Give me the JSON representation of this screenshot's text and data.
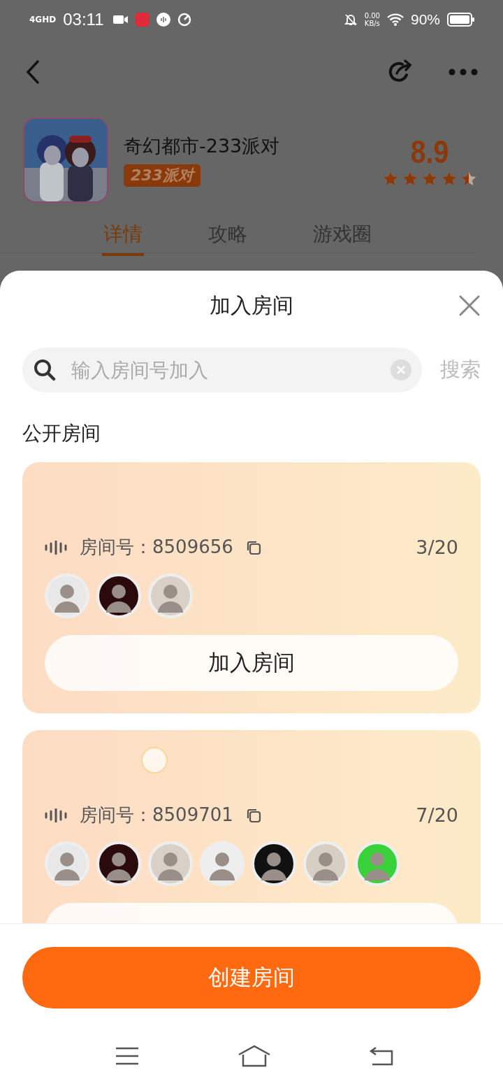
{
  "status_bar": {
    "network": "4GHD",
    "time": "03:11",
    "speed": "0.00",
    "speed_unit": "KB/s",
    "battery": "90%"
  },
  "game": {
    "title": "奇幻都市-233派对",
    "tag": "233派对",
    "score": "8.9",
    "stars": 4.5
  },
  "tabs": [
    {
      "label": "详情",
      "selected": true
    },
    {
      "label": "攻略",
      "selected": false
    },
    {
      "label": "游戏圈",
      "selected": false
    }
  ],
  "sheet": {
    "title": "加入房间",
    "search": {
      "placeholder": "输入房间号加入",
      "button": "搜索"
    },
    "section_title": "公开房间",
    "rooms": [
      {
        "label": "房间号：",
        "number": "8509656",
        "count": "3/20",
        "join": "加入房间"
      },
      {
        "label": "房间号：",
        "number": "8509701",
        "count": "7/20"
      }
    ],
    "create_button": "创建房间"
  }
}
